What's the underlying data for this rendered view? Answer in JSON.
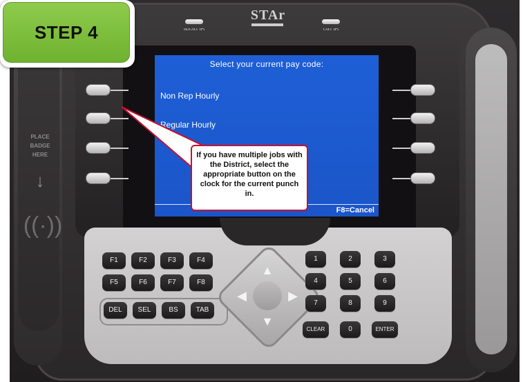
{
  "step_badge": {
    "label": "STEP 4"
  },
  "device": {
    "led_invalid": "INVALID",
    "led_valid": "VALID",
    "logo": "STAr",
    "badge_label": "PLACE\nBADGE\nHERE",
    "screen": {
      "title": "Select your current pay code:",
      "options": [
        "Non Rep Hourly",
        "Regular Hourly"
      ],
      "cancel_hint": "F8=Cancel"
    },
    "function_keys": [
      "F1",
      "F2",
      "F3",
      "F4",
      "F5",
      "F6",
      "F7",
      "F8"
    ],
    "edit_keys": [
      "DEL",
      "SEL",
      "BS",
      "TAB"
    ],
    "number_keys": [
      "1",
      "2",
      "3",
      "4",
      "5",
      "6",
      "7",
      "8",
      "9"
    ],
    "bottom_keys": {
      "clear": "CLEAR",
      "zero": "0",
      "enter": "ENTER"
    }
  },
  "callout": {
    "text": "If you have multiple jobs with the District, select the appropriate button on the clock for the current punch in."
  },
  "colors": {
    "screen_blue": "#1e5fd6",
    "step_green": "#7ebd3c",
    "callout_border": "#c8102e"
  }
}
